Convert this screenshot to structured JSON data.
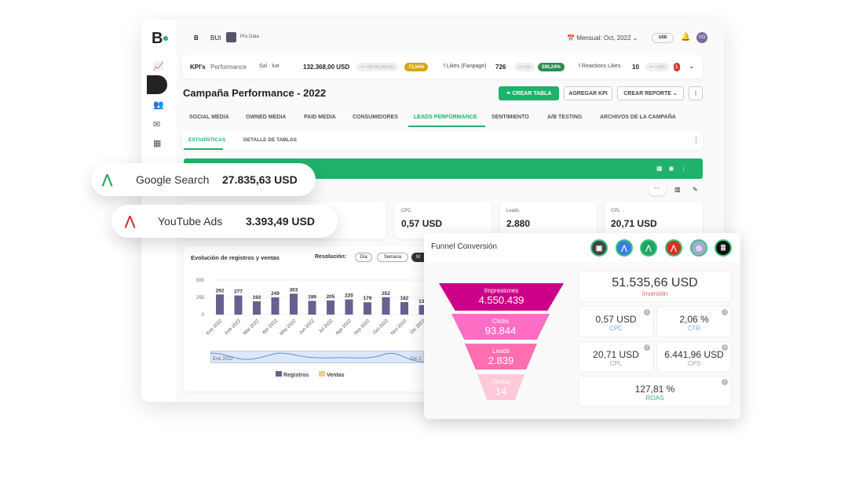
{
  "header": {
    "logo": "B",
    "workspace_logo": "B",
    "workspace_short": "BUI",
    "project": "Pro Data",
    "period": "Mensual: Oct, 2022",
    "currency": "USD",
    "avatar": "VG"
  },
  "kpi_bar": {
    "label": "KPI's",
    "sub": "Performance",
    "items": [
      {
        "name": "Sal  ·  lue",
        "value": "132.368,00 USD",
        "target": ">= 180.000,00USD",
        "pct": "73,54%",
        "pct_color": "#d4a514"
      },
      {
        "name": "Likes (Fanpage)",
        "value": "726",
        "target": ">= 123",
        "pct": "590,24%",
        "pct_color": "#2e8b57"
      },
      {
        "name": "Reactions Likes",
        "value": "10",
        "target": ">= 1.000",
        "pct": "1",
        "pct_color": "#d03a2c"
      }
    ]
  },
  "page": {
    "title": "Campaña Performance - 2022",
    "buttons": {
      "create_table": "CREAR TABLA",
      "add_kpi": "AGREGAR KPI",
      "create_report": "CREAR REPORTE"
    }
  },
  "tabs": [
    {
      "label": "SOCIAL MEDIA"
    },
    {
      "label": "OWNED MEDIA"
    },
    {
      "label": "PAID MEDIA"
    },
    {
      "label": "CONSUMIDORES"
    },
    {
      "label": "LEADS PERFORMANCE",
      "active": true
    },
    {
      "label": "SENTIMIENTO"
    },
    {
      "label": "A/B TESTING"
    },
    {
      "label": "ARCHIVOS DE LA CAMPAÑA"
    }
  ],
  "subtabs": [
    {
      "label": "ESTADÍSTICAS",
      "active": true
    },
    {
      "label": "DETALLE DE TABLAS"
    }
  ],
  "metrics": [
    {
      "label": "CPC",
      "value": "0,57 USD"
    },
    {
      "label": "Leads",
      "value": "2.880"
    },
    {
      "label": "CPL",
      "value": "20,71 USD"
    }
  ],
  "floating": [
    {
      "name": "Google Search",
      "value": "27.835,63 USD",
      "color": "#1fa463"
    },
    {
      "name": "YouTube Ads",
      "value": "3.393,49 USD",
      "color": "#d93025"
    }
  ],
  "chart_data": {
    "type": "bar",
    "title": "Evolución de registros y ventas",
    "resolution_label": "Resolución:",
    "resolution_options": [
      "Día",
      "Semana",
      "M"
    ],
    "categories": [
      "Ene 2022",
      "Feb 2022",
      "Mar 2022",
      "Abr 2022",
      "May 2022",
      "Jun 2022",
      "Jul 2022",
      "Ago 2022",
      "Sep 2022",
      "Oct 2022",
      "Nov 2022",
      "Dic 2022"
    ],
    "series": [
      {
        "name": "Registros",
        "values": [
          292,
          277,
          192,
          249,
          303,
          199,
          205,
          220,
          179,
          252,
          182,
          138
        ],
        "color": "#6b5f8f"
      },
      {
        "name": "Ventas",
        "values": [],
        "color": "#f5c98a"
      }
    ],
    "yticks": [
      0,
      250,
      500
    ],
    "ylim": [
      0,
      500
    ],
    "range_start": "Ene 2022",
    "range_end": "Dic 2",
    "legend": "bottom"
  },
  "funnel": {
    "title": "Funnel Conversión",
    "stages": [
      {
        "label": "Impresiones",
        "value": "4.550.439",
        "color": "#cc0088"
      },
      {
        "label": "Clicks",
        "value": "93.844",
        "color": "#ff6ec4"
      },
      {
        "label": "Leads",
        "value": "2.839",
        "color": "#ff6faf"
      },
      {
        "label": "Ventas",
        "value": "14",
        "color": "#ffc9d9"
      }
    ],
    "investment": {
      "value": "51.535,66 USD",
      "label": "Inversión"
    },
    "cards": [
      {
        "value": "0,57 USD",
        "label": "CPC",
        "color": "#6fa8f5"
      },
      {
        "value": "2,06 %",
        "label": "CTR",
        "color": "#6fa8f5"
      },
      {
        "value": "20,71 USD",
        "label": "CPL",
        "color": "#9aa"
      },
      {
        "value": "6.441,96 USD",
        "label": "CPS",
        "color": "#9aa"
      },
      {
        "value": "127,81 %",
        "label": "ROAS",
        "color": "#3cb371"
      }
    ],
    "sources": [
      {
        "icon": "briefcase-icon",
        "color": "#444"
      },
      {
        "icon": "google-ads-icon",
        "color": "#3b7be8"
      },
      {
        "icon": "google-ads-icon",
        "color": "#1fa463"
      },
      {
        "icon": "google-ads-icon",
        "color": "#d93025"
      },
      {
        "icon": "target-icon",
        "color": "#a9a6d6"
      },
      {
        "icon": "database-icon",
        "color": "#111"
      }
    ]
  }
}
